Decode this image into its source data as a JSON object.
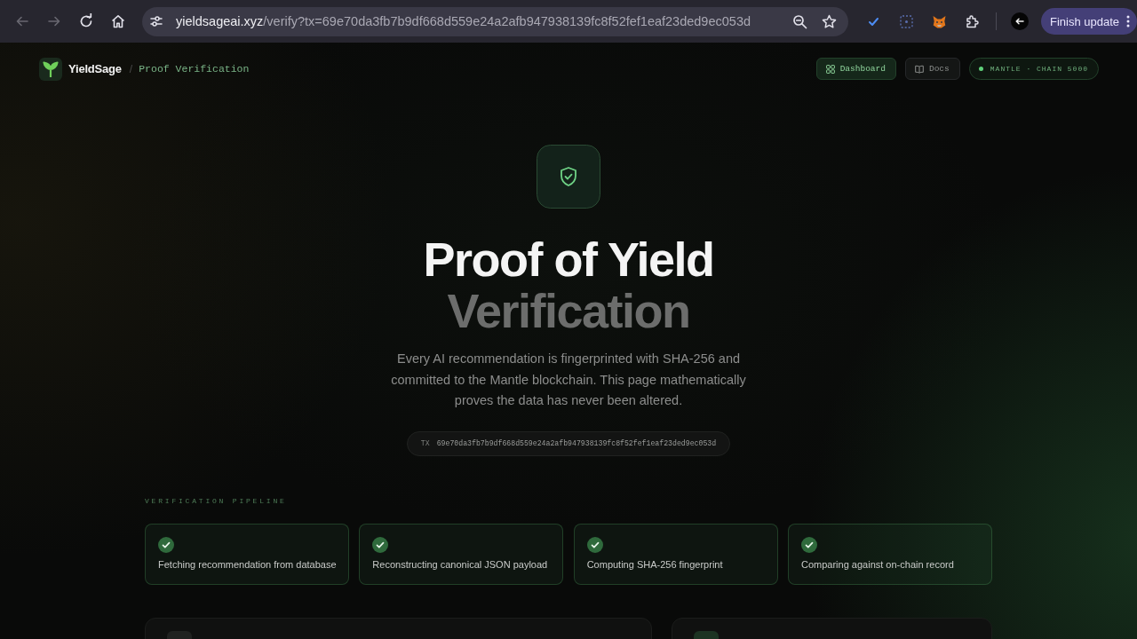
{
  "browser": {
    "url_host": "yieldsageai.xyz",
    "url_path": "/verify?tx=69e70da3fb7b9df668d559e24a2afb947938139fc8f52fef1eaf23ded9ec053d",
    "back_disabled": true,
    "forward_disabled": true,
    "update_button": "Finish update"
  },
  "header": {
    "brand": "YieldSage",
    "separator": "/",
    "page": "Proof Verification",
    "nav": [
      {
        "label": "Dashboard",
        "selected": true
      },
      {
        "label": "Docs",
        "selected": false
      }
    ],
    "network": "MANTLE · CHAIN 5000"
  },
  "hero": {
    "title": "Proof of Yield",
    "subtitle": "Verification",
    "description": "Every AI recommendation is fingerprinted with SHA-256 and committed to the Mantle blockchain. This page mathematically proves the data has never been altered.",
    "tx_label": "TX",
    "tx_hash": "69e70da3fb7b9df668d559e24a2afb947938139fc8f52fef1eaf23ded9ec053d"
  },
  "pipeline": {
    "label": "VERIFICATION PIPELINE",
    "steps": [
      {
        "label": "Fetching recommendation from database",
        "done": true
      },
      {
        "label": "Reconstructing canonical JSON payload",
        "done": true
      },
      {
        "label": "Computing SHA-256 fingerprint",
        "done": true
      },
      {
        "label": "Comparing against on-chain record",
        "done": true
      }
    ]
  },
  "panels": [
    {
      "kind": "wide"
    },
    {
      "kind": "narrow"
    }
  ]
}
